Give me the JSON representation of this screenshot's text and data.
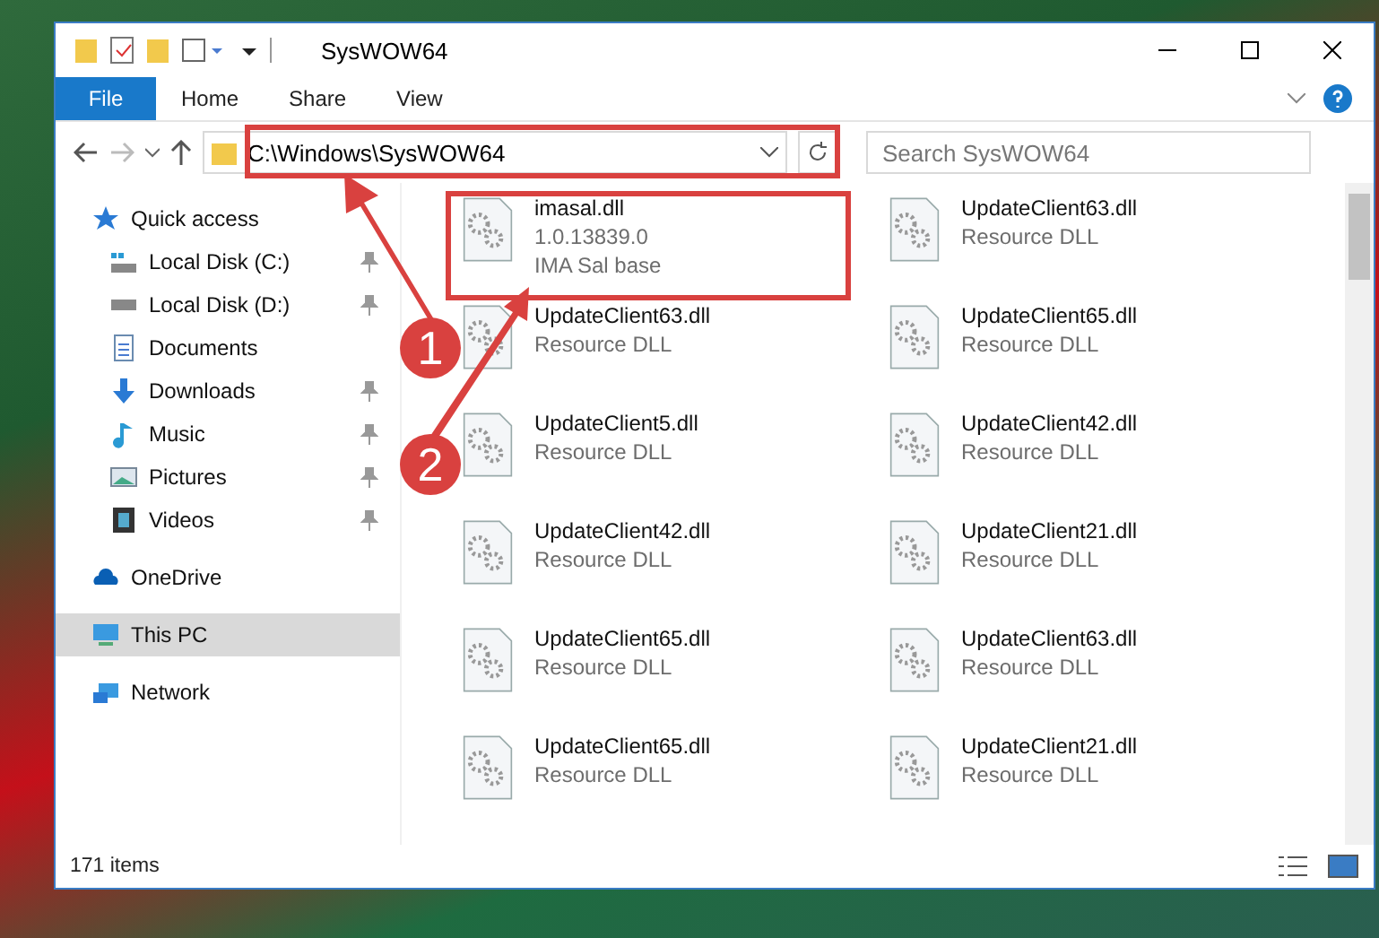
{
  "window": {
    "title": "SysWOW64"
  },
  "ribbon_tabs": [
    {
      "label": "File",
      "selected": true
    },
    {
      "label": "Home",
      "selected": false
    },
    {
      "label": "Share",
      "selected": false
    },
    {
      "label": "View",
      "selected": false
    }
  ],
  "address": {
    "path": "C:\\Windows\\SysWOW64"
  },
  "search": {
    "placeholder": "Search SysWOW64"
  },
  "sidebar": {
    "items": [
      {
        "label": "Quick access",
        "kind": "star",
        "pinned": false,
        "selected": false,
        "children": [
          {
            "label": "Local Disk (C:)",
            "kind": "drive-c",
            "pinned": true,
            "selected": false
          },
          {
            "label": "Local Disk (D:)",
            "kind": "drive",
            "pinned": true,
            "selected": false
          },
          {
            "label": "Documents",
            "kind": "document",
            "pinned": false,
            "selected": false
          },
          {
            "label": "Downloads",
            "kind": "download",
            "pinned": true,
            "selected": false
          },
          {
            "label": "Music",
            "kind": "music",
            "pinned": true,
            "selected": false
          },
          {
            "label": "Pictures",
            "kind": "picture",
            "pinned": true,
            "selected": false
          },
          {
            "label": "Videos",
            "kind": "video",
            "pinned": true,
            "selected": false
          }
        ]
      },
      {
        "label": "OneDrive",
        "kind": "cloud",
        "pinned": false,
        "selected": false
      },
      {
        "label": "This PC",
        "kind": "pc",
        "pinned": false,
        "selected": true
      },
      {
        "label": "Network",
        "kind": "network",
        "pinned": false,
        "selected": false
      }
    ]
  },
  "files": [
    {
      "name": "imasal.dll",
      "details": [
        "1.0.13839.0",
        "IMA Sal base"
      ]
    },
    {
      "name": "UpdateClient63.dll",
      "details": [
        "Resource DLL"
      ]
    },
    {
      "name": "UpdateClient63.dll",
      "details": [
        "Resource DLL"
      ]
    },
    {
      "name": "UpdateClient65.dll",
      "details": [
        "Resource DLL"
      ]
    },
    {
      "name": "UpdateClient5.dll",
      "details": [
        "Resource DLL"
      ]
    },
    {
      "name": "UpdateClient42.dll",
      "details": [
        "Resource DLL"
      ]
    },
    {
      "name": "UpdateClient42.dll",
      "details": [
        "Resource DLL"
      ]
    },
    {
      "name": "UpdateClient21.dll",
      "details": [
        "Resource DLL"
      ]
    },
    {
      "name": "UpdateClient65.dll",
      "details": [
        "Resource DLL"
      ]
    },
    {
      "name": "UpdateClient63.dll",
      "details": [
        "Resource DLL"
      ]
    },
    {
      "name": "UpdateClient65.dll",
      "details": [
        "Resource DLL"
      ]
    },
    {
      "name": "UpdateClient21.dll",
      "details": [
        "Resource DLL"
      ]
    }
  ],
  "status_bar": {
    "count": "171 items"
  },
  "annotations": [
    {
      "number": "1"
    },
    {
      "number": "2"
    }
  ]
}
